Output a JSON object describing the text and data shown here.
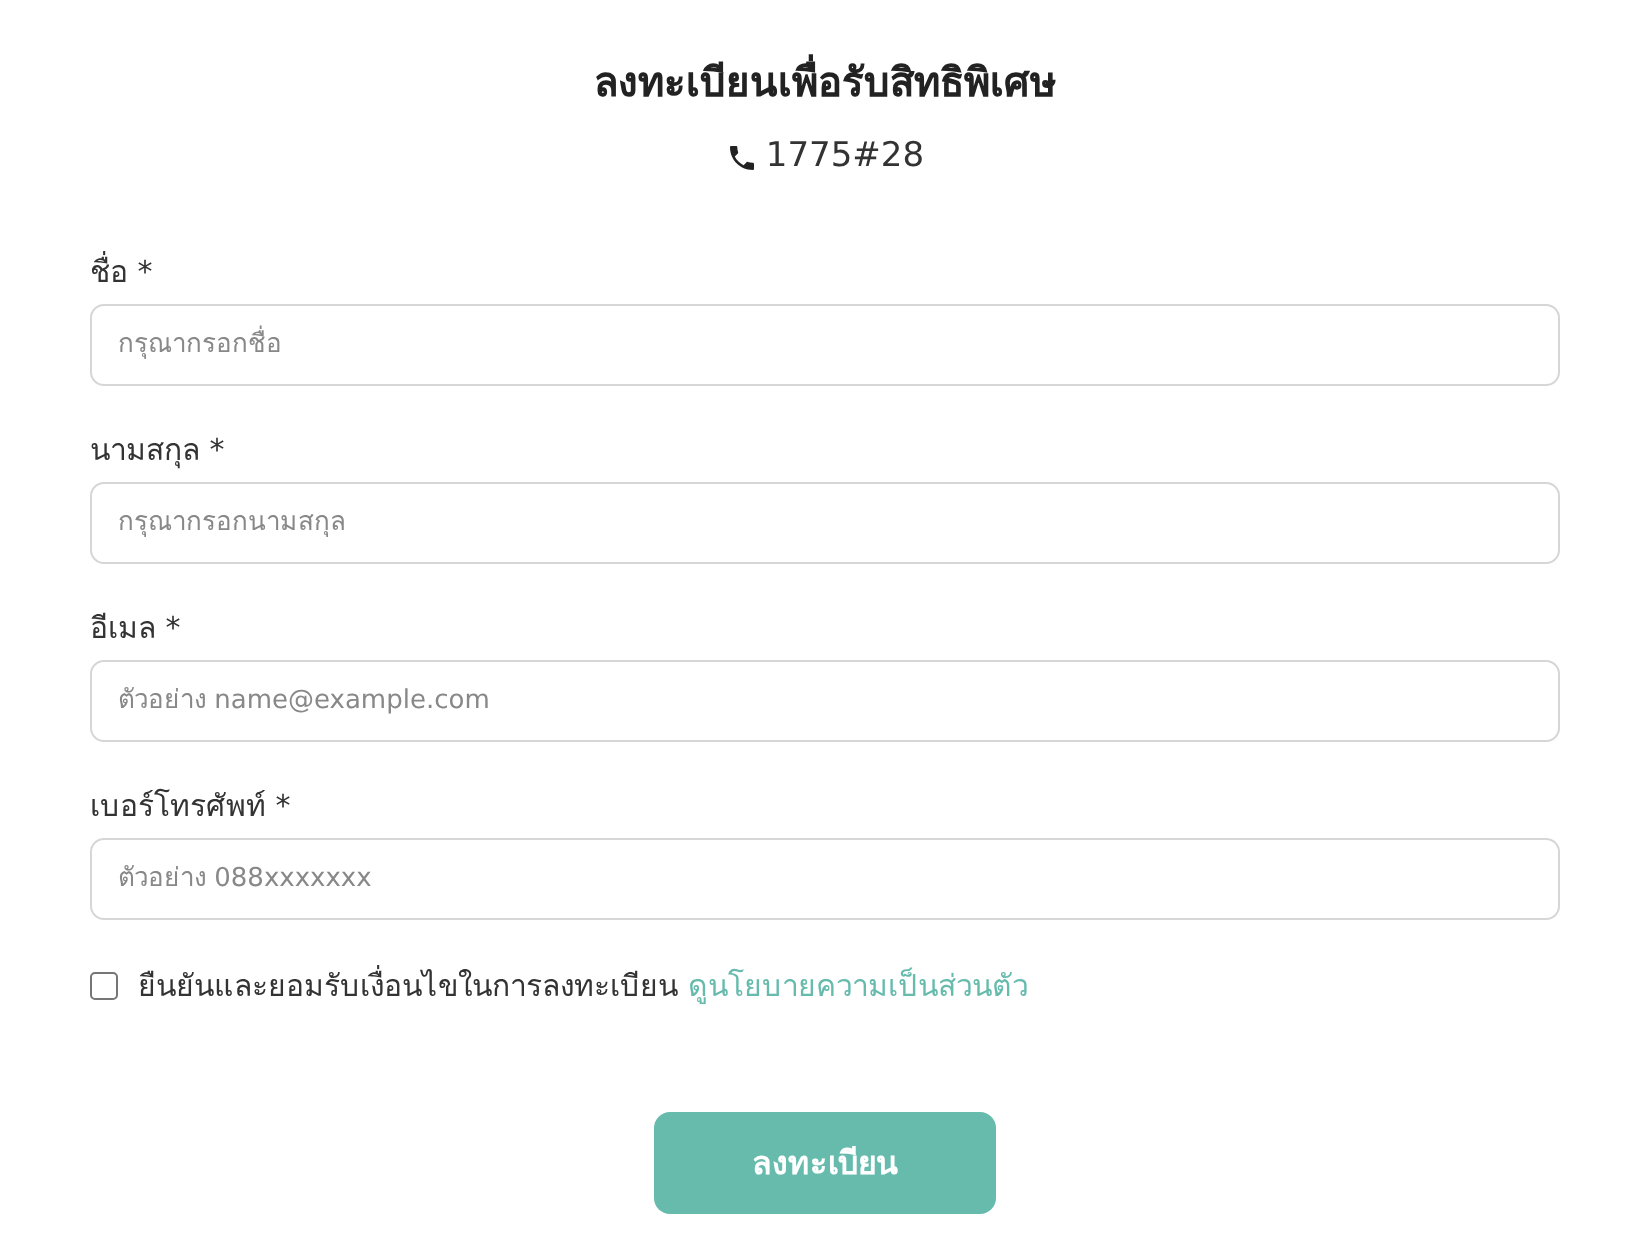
{
  "title": "ลงทะเบียนเพื่อรับสิทธิพิเศษ",
  "phone": "1775#28",
  "fields": [
    {
      "label": "ชื่อ *",
      "placeholder": "กรุณากรอกชื่อ"
    },
    {
      "label": "นามสกุล *",
      "placeholder": "กรุณากรอกนามสกุล"
    },
    {
      "label": "อีเมล *",
      "placeholder": "ตัวอย่าง name@example.com"
    },
    {
      "label": "เบอร์โทรศัพท์ *",
      "placeholder": "ตัวอย่าง 088xxxxxxx"
    }
  ],
  "consent": {
    "checked": false,
    "text": "ยืนยันและยอมรับเงื่อนไขในการลงทะเบียน",
    "link": "ดูนโยบายความเป็นส่วนตัว"
  },
  "submit": "ลงทะเบียน"
}
